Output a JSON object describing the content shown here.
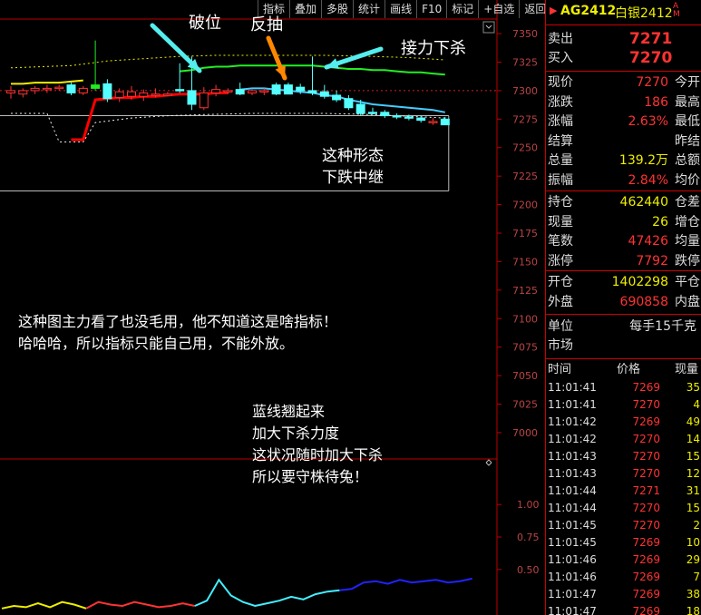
{
  "toolbar": [
    "指标",
    "叠加",
    "多股",
    "统计",
    "画线",
    "F10",
    "标记",
    "+自选",
    "返回"
  ],
  "header": {
    "code": "AG2412",
    "name": "白银2412",
    "badge": "A M"
  },
  "annotations": {
    "break": "破位",
    "pullback": "反抽",
    "relay": "接力下杀",
    "pattern": [
      "这种形态",
      "下跌中继"
    ],
    "note": [
      "这种图主力看了也没毛用，他不知道这是啥指标！",
      "哈哈哈，所以指标只能自己用，不能外放。"
    ],
    "blue": [
      "蓝线翘起来",
      "加大下杀力度",
      "这状况随时加大下杀",
      "所以要守株待兔！"
    ]
  },
  "quotes": {
    "ask": {
      "label": "卖出",
      "value": "7271"
    },
    "bid": {
      "label": "买入",
      "value": "7270"
    },
    "stats": [
      {
        "label": "现价",
        "value": "7270",
        "label2": "今开"
      },
      {
        "label": "涨跌",
        "value": "186",
        "label2": "最高"
      },
      {
        "label": "涨幅",
        "value": "2.63%",
        "label2": "最低"
      },
      {
        "label": "结算",
        "value": "",
        "label2": "昨结"
      },
      {
        "label": "总量",
        "value": "139.2万",
        "label2": "总额"
      },
      {
        "label": "振幅",
        "value": "2.84%",
        "label2": "均价"
      }
    ],
    "positions": [
      {
        "label": "持仓",
        "value": "462440",
        "label2": "仓差"
      },
      {
        "label": "现量",
        "value": "26",
        "label2": "增仓"
      },
      {
        "label": "笔数",
        "value": "47426",
        "label2": "均量"
      },
      {
        "label": "涨停",
        "value": "7792",
        "label2": "跌停"
      }
    ],
    "flows": [
      {
        "label": "开仓",
        "value": "1402298",
        "label2": "平仓"
      },
      {
        "label": "外盘",
        "value": "690858",
        "label2": "内盘"
      }
    ],
    "unit": {
      "label": "单位",
      "value": "每手15千克"
    },
    "market": {
      "label": "市场"
    }
  },
  "ticks": {
    "headers": [
      "时间",
      "价格",
      "现量"
    ],
    "rows": [
      [
        "11:01:41",
        "7269",
        "35"
      ],
      [
        "11:01:41",
        "7270",
        "4"
      ],
      [
        "11:01:42",
        "7269",
        "49"
      ],
      [
        "11:01:42",
        "7270",
        "14"
      ],
      [
        "11:01:43",
        "7270",
        "15"
      ],
      [
        "11:01:43",
        "7270",
        "12"
      ],
      [
        "11:01:44",
        "7271",
        "31"
      ],
      [
        "11:01:44",
        "7270",
        "15"
      ],
      [
        "11:01:45",
        "7270",
        "2"
      ],
      [
        "11:01:45",
        "7269",
        "10"
      ],
      [
        "11:01:46",
        "7269",
        "29"
      ],
      [
        "11:01:46",
        "7269",
        "7"
      ],
      [
        "11:01:47",
        "7269",
        "38"
      ],
      [
        "11:01:47",
        "7269",
        "18"
      ]
    ]
  },
  "chart_data": [
    {
      "type": "candlestick",
      "y_ticks": [
        7350,
        7325,
        7300,
        7275,
        7250,
        7225,
        7200,
        7175,
        7150,
        7125,
        7100,
        7075,
        7050,
        7025,
        7000
      ],
      "ylim": [
        6988,
        7362
      ],
      "candles": [
        {
          "o": 7300,
          "h": 7304,
          "l": 7293,
          "c": 7298,
          "color": "red"
        },
        {
          "o": 7297,
          "h": 7302,
          "l": 7294,
          "c": 7300,
          "color": "red"
        },
        {
          "o": 7300,
          "h": 7304,
          "l": 7297,
          "c": 7302,
          "color": "red"
        },
        {
          "o": 7301,
          "h": 7305,
          "l": 7298,
          "c": 7302,
          "color": "red"
        },
        {
          "o": 7302,
          "h": 7305,
          "l": 7300,
          "c": 7303,
          "color": "red"
        },
        {
          "o": 7305,
          "h": 7307,
          "l": 7296,
          "c": 7298,
          "color": "cyan"
        },
        {
          "o": 7298,
          "h": 7304,
          "l": 7296,
          "c": 7302,
          "color": "red"
        },
        {
          "o": 7302,
          "h": 7344,
          "l": 7300,
          "c": 7305,
          "color": "green"
        },
        {
          "o": 7306,
          "h": 7310,
          "l": 7290,
          "c": 7293,
          "color": "cyan"
        },
        {
          "o": 7294,
          "h": 7302,
          "l": 7290,
          "c": 7299,
          "color": "red"
        },
        {
          "o": 7299,
          "h": 7304,
          "l": 7292,
          "c": 7295,
          "color": "red"
        },
        {
          "o": 7295,
          "h": 7301,
          "l": 7291,
          "c": 7298,
          "color": "red"
        },
        {
          "o": 7297,
          "h": 7302,
          "l": 7294,
          "c": 7296,
          "color": "red"
        },
        {
          "o": 7296,
          "h": 7299,
          "l": 7295,
          "c": 7297,
          "color": "red"
        },
        {
          "o": 7301,
          "h": 7324,
          "l": 7298,
          "c": 7300,
          "color": "cyan"
        },
        {
          "o": 7300,
          "h": 7330,
          "l": 7283,
          "c": 7288,
          "color": "cyan"
        },
        {
          "o": 7285,
          "h": 7303,
          "l": 7283,
          "c": 7298,
          "color": "red"
        },
        {
          "o": 7298,
          "h": 7305,
          "l": 7295,
          "c": 7301,
          "color": "red"
        },
        {
          "o": 7300,
          "h": 7302,
          "l": 7297,
          "c": 7299,
          "color": "red"
        },
        {
          "o": 7301,
          "h": 7307,
          "l": 7296,
          "c": 7297,
          "color": "cyan"
        },
        {
          "o": 7298,
          "h": 7301,
          "l": 7296,
          "c": 7300,
          "color": "red"
        },
        {
          "o": 7300,
          "h": 7302,
          "l": 7296,
          "c": 7299,
          "color": "red"
        },
        {
          "o": 7305,
          "h": 7307,
          "l": 7296,
          "c": 7297,
          "color": "cyan"
        },
        {
          "o": 7305,
          "h": 7307,
          "l": 7297,
          "c": 7297,
          "color": "cyan"
        },
        {
          "o": 7303,
          "h": 7306,
          "l": 7297,
          "c": 7300,
          "color": "cyan"
        },
        {
          "o": 7300,
          "h": 7330,
          "l": 7296,
          "c": 7298,
          "color": "cyan"
        },
        {
          "o": 7299,
          "h": 7305,
          "l": 7293,
          "c": 7295,
          "color": "cyan"
        },
        {
          "o": 7296,
          "h": 7300,
          "l": 7290,
          "c": 7292,
          "color": "cyan"
        },
        {
          "o": 7293,
          "h": 7296,
          "l": 7283,
          "c": 7285,
          "color": "cyan"
        },
        {
          "o": 7288,
          "h": 7292,
          "l": 7278,
          "c": 7280,
          "color": "cyan"
        },
        {
          "o": 7281,
          "h": 7285,
          "l": 7279,
          "c": 7281,
          "color": "cyan"
        },
        {
          "o": 7281,
          "h": 7283,
          "l": 7276,
          "c": 7278,
          "color": "cyan"
        },
        {
          "o": 7278,
          "h": 7280,
          "l": 7275,
          "c": 7277,
          "color": "cyan"
        },
        {
          "o": 7277,
          "h": 7279,
          "l": 7274,
          "c": 7276,
          "color": "cyan"
        },
        {
          "o": 7276,
          "h": 7278,
          "l": 7272,
          "c": 7274,
          "color": "cyan"
        },
        {
          "o": 7273,
          "h": 7276,
          "l": 7270,
          "c": 7273,
          "color": "red"
        },
        {
          "o": 7275,
          "h": 7277,
          "l": 7270,
          "c": 7270,
          "color": "cyan"
        }
      ],
      "lines": {
        "green": [
          [
            14,
            7317
          ],
          [
            15,
            7318
          ],
          [
            16,
            7320
          ],
          [
            17,
            7321
          ],
          [
            18,
            7321
          ],
          [
            19,
            7322
          ],
          [
            20,
            7322
          ],
          [
            21,
            7322
          ],
          [
            22,
            7322
          ],
          [
            23,
            7322
          ],
          [
            24,
            7322
          ],
          [
            25,
            7322
          ],
          [
            26,
            7321
          ],
          [
            27,
            7320
          ],
          [
            28,
            7319
          ],
          [
            29,
            7319
          ],
          [
            30,
            7318
          ],
          [
            31,
            7318
          ],
          [
            32,
            7317
          ],
          [
            33,
            7316
          ],
          [
            34,
            7316
          ],
          [
            35,
            7315
          ],
          [
            36,
            7314
          ]
        ],
        "red": [
          [
            5,
            7257
          ],
          [
            6,
            7257
          ],
          [
            7,
            7292
          ],
          [
            8,
            7293
          ],
          [
            9,
            7294
          ],
          [
            10,
            7294
          ],
          [
            11,
            7295
          ],
          [
            12,
            7295
          ],
          [
            13,
            7296
          ],
          [
            14,
            7297
          ],
          [
            15,
            7297
          ],
          [
            16,
            7297
          ],
          [
            17,
            7298
          ],
          [
            18,
            7298
          ]
        ],
        "yellow": [
          [
            0,
            7306
          ],
          [
            1,
            7306
          ],
          [
            2,
            7307
          ],
          [
            3,
            7307
          ],
          [
            4,
            7307
          ],
          [
            5,
            7308
          ],
          [
            6,
            7309
          ]
        ],
        "cyan": [
          [
            19,
            7301
          ],
          [
            20,
            7302
          ],
          [
            21,
            7302
          ],
          [
            22,
            7301
          ],
          [
            23,
            7300
          ],
          [
            24,
            7299
          ],
          [
            25,
            7298
          ],
          [
            26,
            7296
          ],
          [
            27,
            7295
          ],
          [
            28,
            7292
          ],
          [
            29,
            7290
          ],
          [
            30,
            7288
          ],
          [
            31,
            7287
          ],
          [
            32,
            7286
          ],
          [
            33,
            7285
          ],
          [
            34,
            7284
          ],
          [
            35,
            7283
          ],
          [
            36,
            7281
          ]
        ],
        "upper_dotted": [
          [
            0,
            7320
          ],
          [
            5,
            7322
          ],
          [
            8,
            7326
          ],
          [
            11,
            7328
          ],
          [
            14,
            7330
          ],
          [
            17,
            7331
          ],
          [
            20,
            7331
          ],
          [
            23,
            7331
          ],
          [
            26,
            7331
          ],
          [
            30,
            7330
          ],
          [
            33,
            7329
          ],
          [
            36,
            7327
          ]
        ],
        "lower_dotted": [
          [
            0,
            7280
          ],
          [
            3,
            7280
          ],
          [
            4,
            7255
          ],
          [
            6,
            7255
          ],
          [
            7,
            7272
          ],
          [
            10,
            7276
          ],
          [
            13,
            7278
          ],
          [
            16,
            7279
          ],
          [
            20,
            7280
          ],
          [
            23,
            7280
          ],
          [
            26,
            7280
          ],
          [
            30,
            7279
          ],
          [
            36,
            7276
          ]
        ],
        "red_dotted_level": 7300
      }
    },
    {
      "type": "line",
      "y_ticks": [
        1.0,
        0.75,
        0.5
      ],
      "ylim": [
        0.15,
        1.35
      ],
      "series": [
        {
          "color": "yellow",
          "values": [
            0.2,
            0.22,
            0.21,
            0.24,
            0.21,
            0.25,
            0.23,
            0.2
          ]
        },
        {
          "color": "red",
          "values": [
            0.2,
            0.25,
            0.23,
            0.22,
            0.25,
            0.23,
            0.21,
            0.22,
            0.24,
            0.22
          ]
        },
        {
          "color": "cyan",
          "values": [
            0.22,
            0.26,
            0.42,
            0.3,
            0.25,
            0.22,
            0.24,
            0.26,
            0.29,
            0.27,
            0.31,
            0.33,
            0.34
          ]
        },
        {
          "color": "blue",
          "values": [
            0.34,
            0.35,
            0.4,
            0.41,
            0.39,
            0.42,
            0.4,
            0.41,
            0.42,
            0.4,
            0.41,
            0.43
          ]
        }
      ]
    }
  ]
}
